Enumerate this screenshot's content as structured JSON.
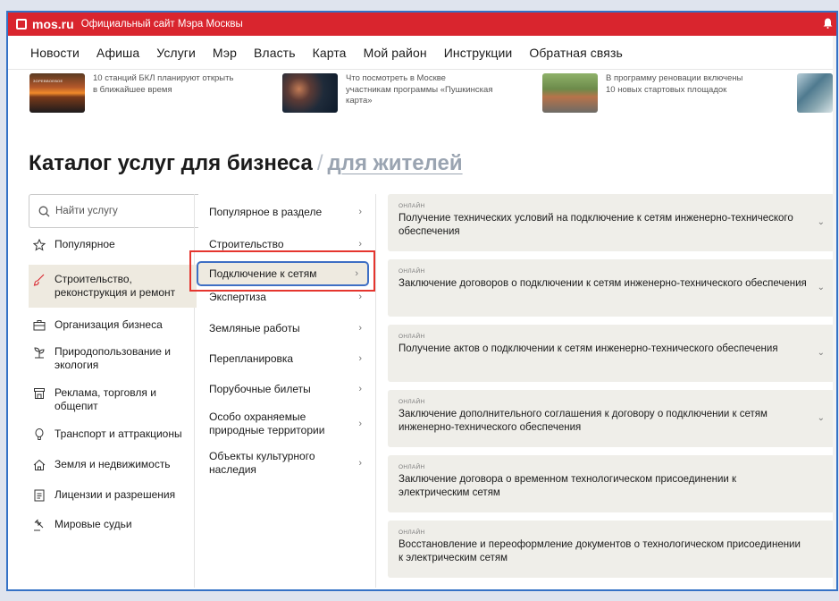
{
  "topbar": {
    "logo": "mos.ru",
    "site_title": "Официальный сайт Мэра Москвы"
  },
  "nav": [
    "Новости",
    "Афиша",
    "Услуги",
    "Мэр",
    "Власть",
    "Карта",
    "Мой район",
    "Инструкции",
    "Обратная связь"
  ],
  "news": [
    {
      "text": "10 станций БКЛ планируют открыть в ближайшее время",
      "thumb_text": "ЗОРЕВВОЕВОЕ"
    },
    {
      "text": "Что посмотреть в Москве участникам программы «Пушкинская карта»"
    },
    {
      "text": "В программу реновации включены 10 новых стартовых площадок"
    }
  ],
  "page_title": {
    "main": "Каталог услуг для бизнеса",
    "separator": "/",
    "alt": "для жителей"
  },
  "search": {
    "placeholder": "Найти услугу"
  },
  "categories": [
    {
      "label": "Популярное",
      "icon": "star-icon"
    },
    {
      "label": "Строительство, реконструкция и ремонт",
      "icon": "brush-icon",
      "active": true
    },
    {
      "label": "Организация бизнеса",
      "icon": "briefcase-icon"
    },
    {
      "label": "Природопользование и экология",
      "icon": "sprout-icon"
    },
    {
      "label": "Реклама, торговля и общепит",
      "icon": "shop-icon"
    },
    {
      "label": "Транспорт и аттракционы",
      "icon": "balloon-icon"
    },
    {
      "label": "Земля и недвижимость",
      "icon": "house-icon"
    },
    {
      "label": "Лицензии и разрешения",
      "icon": "document-icon"
    },
    {
      "label": "Мировые судьи",
      "icon": "gavel-icon"
    }
  ],
  "subcategories": [
    {
      "label": "Популярное в разделе"
    },
    {
      "label": "Строительство"
    },
    {
      "label": "Подключение к сетям",
      "active": true
    },
    {
      "label": "Экспертиза"
    },
    {
      "label": "Земляные работы"
    },
    {
      "label": "Перепланировка"
    },
    {
      "label": "Порубочные билеты"
    },
    {
      "label": "Особо охраняемые природные территории"
    },
    {
      "label": "Объекты культурного наследия"
    }
  ],
  "services": [
    {
      "tag": "онлайн",
      "title": "Получение технических условий на подключение к сетям инженерно-технического обеспечения",
      "expandable": true
    },
    {
      "tag": "онлайн",
      "title": "Заключение договоров о подключении к сетям инженерно-технического обеспечения",
      "expandable": true
    },
    {
      "tag": "онлайн",
      "title": "Получение актов о подключении к сетям инженерно-технического обеспечения",
      "expandable": true
    },
    {
      "tag": "онлайн",
      "title": "Заключение дополнительного соглашения к договору о подключении к сетям инженерно-технического обеспечения",
      "expandable": true
    },
    {
      "tag": "онлайн",
      "title": "Заключение договора о временном технологическом присоединении к электрическим сетям",
      "expandable": false
    },
    {
      "tag": "онлайн",
      "title": "Восстановление и переоформление документов о технологическом присоединении к электрическим сетям",
      "expandable": false
    }
  ],
  "colors": {
    "brand_red": "#d9252e",
    "highlight_bg": "#eeeae0",
    "card_bg": "#efeee9",
    "active_border": "#3e6fc4",
    "annotation_red": "#e5352e"
  }
}
